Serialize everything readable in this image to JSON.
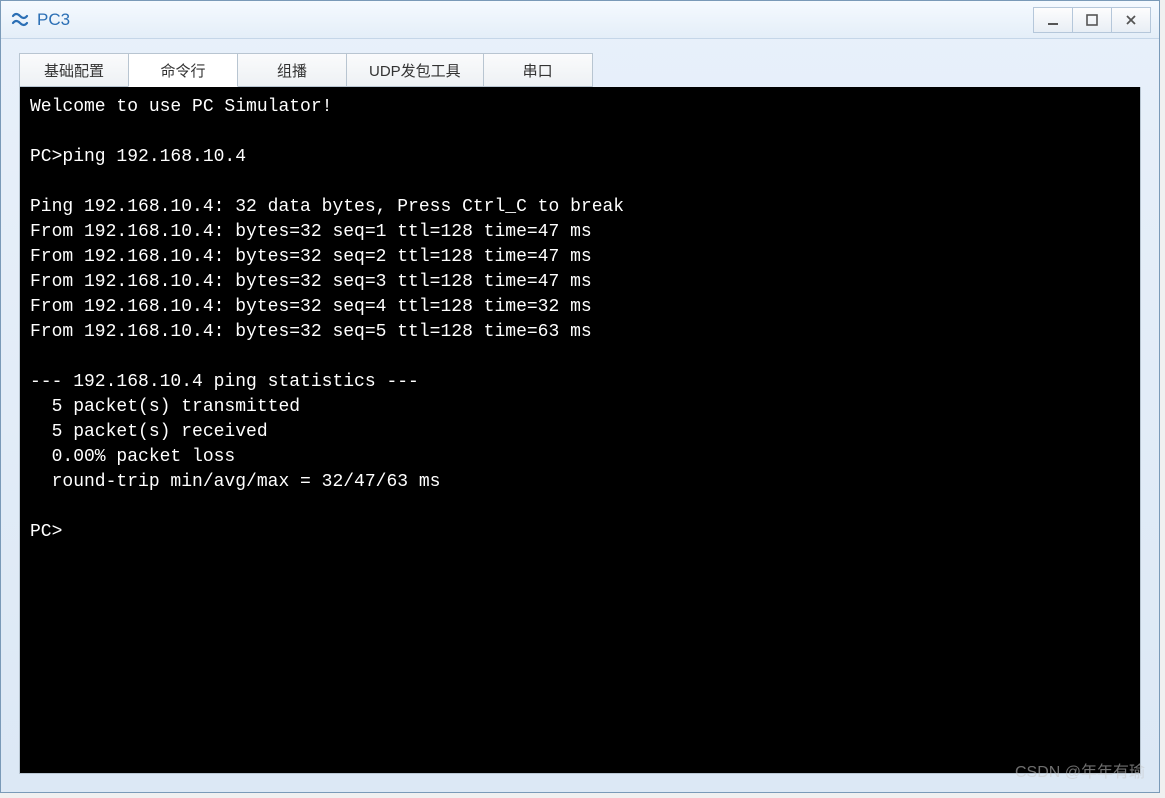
{
  "window": {
    "title": "PC3"
  },
  "tabs": [
    {
      "label": "基础配置",
      "active": false
    },
    {
      "label": "命令行",
      "active": true
    },
    {
      "label": "组播",
      "active": false
    },
    {
      "label": "UDP发包工具",
      "active": false
    },
    {
      "label": "串口",
      "active": false
    }
  ],
  "terminal": {
    "lines": [
      "Welcome to use PC Simulator!",
      "",
      "PC>ping 192.168.10.4",
      "",
      "Ping 192.168.10.4: 32 data bytes, Press Ctrl_C to break",
      "From 192.168.10.4: bytes=32 seq=1 ttl=128 time=47 ms",
      "From 192.168.10.4: bytes=32 seq=2 ttl=128 time=47 ms",
      "From 192.168.10.4: bytes=32 seq=3 ttl=128 time=47 ms",
      "From 192.168.10.4: bytes=32 seq=4 ttl=128 time=32 ms",
      "From 192.168.10.4: bytes=32 seq=5 ttl=128 time=63 ms",
      "",
      "--- 192.168.10.4 ping statistics ---",
      "  5 packet(s) transmitted",
      "  5 packet(s) received",
      "  0.00% packet loss",
      "  round-trip min/avg/max = 32/47/63 ms",
      "",
      "PC>"
    ]
  },
  "watermark": "CSDN @年年有瑜"
}
